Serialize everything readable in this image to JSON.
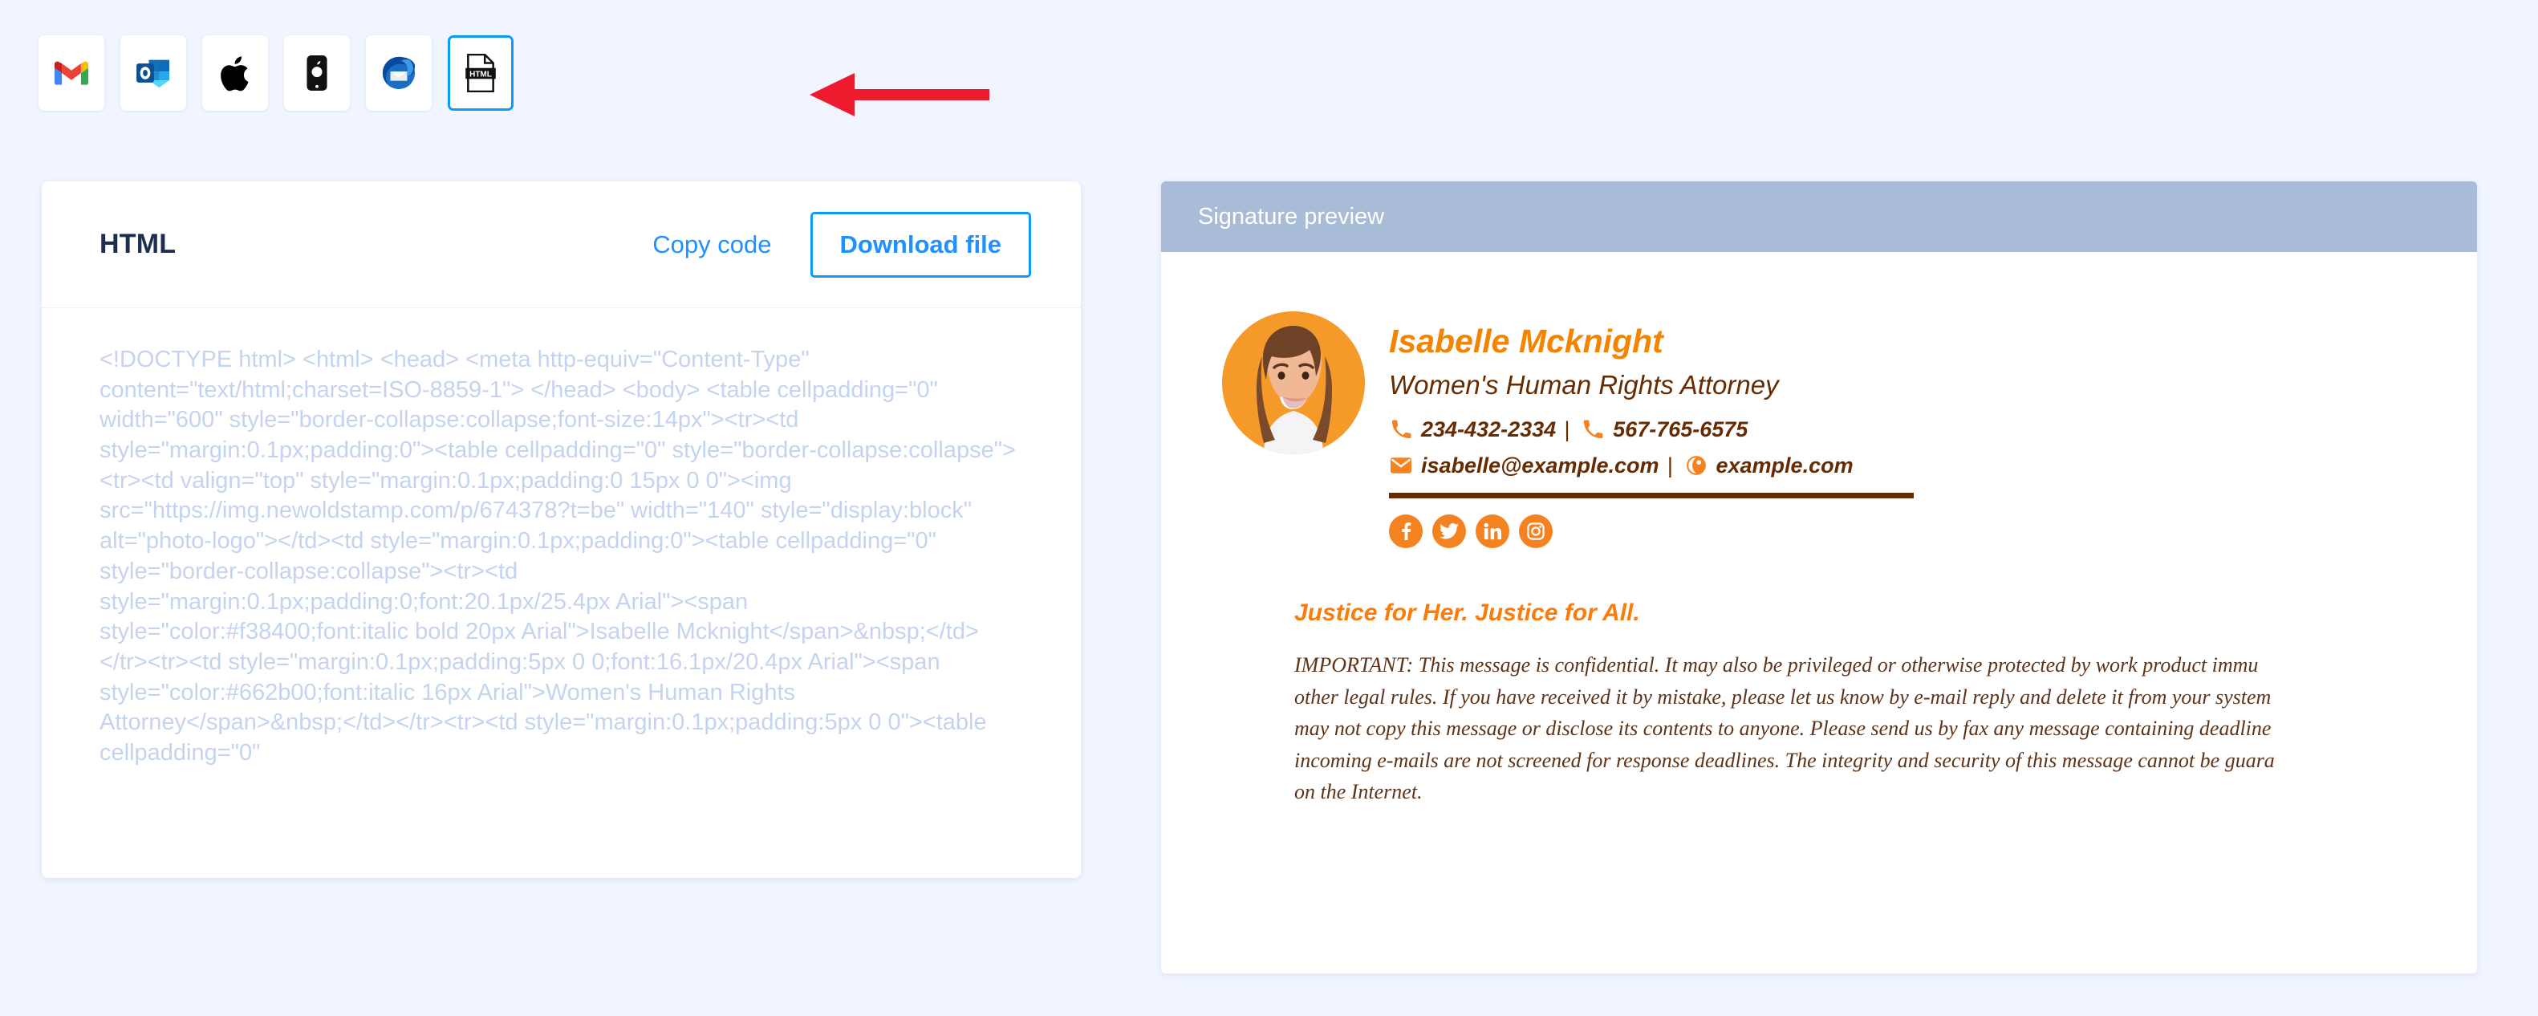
{
  "page": {
    "background_color": "#f0f5ff",
    "accent_blue": "#0b9bf8",
    "brand_orange": "#f38400",
    "brand_brown": "#662b00"
  },
  "client_strip": {
    "items": [
      {
        "id": "gmail",
        "icon": "gmail-icon",
        "label": "Gmail",
        "selected": false
      },
      {
        "id": "outlook",
        "icon": "outlook-icon",
        "label": "Outlook",
        "selected": false
      },
      {
        "id": "apple-mail",
        "icon": "apple-icon",
        "label": "Apple Mail",
        "selected": false
      },
      {
        "id": "ios-mail",
        "icon": "iphone-icon",
        "label": "iOS Mail",
        "selected": false
      },
      {
        "id": "thunderbird",
        "icon": "thunderbird-icon",
        "label": "Thunderbird",
        "selected": false
      },
      {
        "id": "html",
        "icon": "html-file-icon",
        "label": "HTML",
        "selected": true
      }
    ],
    "pointer": {
      "icon": "left-arrow-annotation",
      "color": "#ee1b2e"
    }
  },
  "code_card": {
    "title": "HTML",
    "copy_label": "Copy code",
    "download_label": "Download file",
    "code": "<!DOCTYPE html> <html> <head> <meta http-equiv=\"Content-Type\" content=\"text/html;charset=ISO-8859-1\"> </head> <body> <table cellpadding=\"0\" width=\"600\" style=\"border-collapse:collapse;font-size:14px\"><tr><td style=\"margin:0.1px;padding:0\"><table cellpadding=\"0\" style=\"border-collapse:collapse\"><tr><td valign=\"top\" style=\"margin:0.1px;padding:0 15px 0 0\"><img src=\"https://img.newoldstamp.com/p/674378?t=be\" width=\"140\" style=\"display:block\" alt=\"photo-logo\"></td><td style=\"margin:0.1px;padding:0\"><table cellpadding=\"0\" style=\"border-collapse:collapse\"><tr><td style=\"margin:0.1px;padding:0;font:20.1px/25.4px Arial\"><span style=\"color:#f38400;font:italic bold 20px Arial\">Isabelle Mcknight</span>&nbsp;</td></tr><tr><td style=\"margin:0.1px;padding:5px 0 0;font:16.1px/20.4px Arial\"><span style=\"color:#662b00;font:italic 16px Arial\">Women's Human Rights Attorney</span>&nbsp;</td></tr><tr><td style=\"margin:0.1px;padding:5px 0 0\"><table cellpadding=\"0\""
  },
  "preview": {
    "header_label": "Signature preview",
    "signature": {
      "photo_alt": "photo-logo",
      "name": "Isabelle Mcknight",
      "job_title": "Women's Human Rights Attorney",
      "phone_primary": "234-432-2334",
      "phone_secondary": "567-765-6575",
      "separator": "|",
      "email": "isabelle@example.com",
      "website": "example.com",
      "icons": {
        "phone": "phone-icon",
        "email": "envelope-icon",
        "website": "globe-icon"
      },
      "socials": [
        {
          "id": "facebook",
          "icon": "facebook-icon",
          "color": "#f58220"
        },
        {
          "id": "twitter",
          "icon": "twitter-icon",
          "color": "#f58220"
        },
        {
          "id": "linkedin",
          "icon": "linkedin-icon",
          "color": "#f58220"
        },
        {
          "id": "instagram",
          "icon": "instagram-icon",
          "color": "#f58220"
        }
      ],
      "tagline": "Justice for Her. Justice for All.",
      "disclaimer_lines": [
        "IMPORTANT: This message is confidential. It may also be privileged or otherwise protected by work product immu",
        "other legal rules. If you have received it by mistake, please let us know by e-mail reply and delete it from your system",
        "may not copy this message or disclose its contents to anyone. Please send us by fax any message containing deadline",
        "incoming e-mails are not screened for response deadlines. The integrity and security of this message cannot be guara",
        "on the Internet."
      ]
    }
  }
}
